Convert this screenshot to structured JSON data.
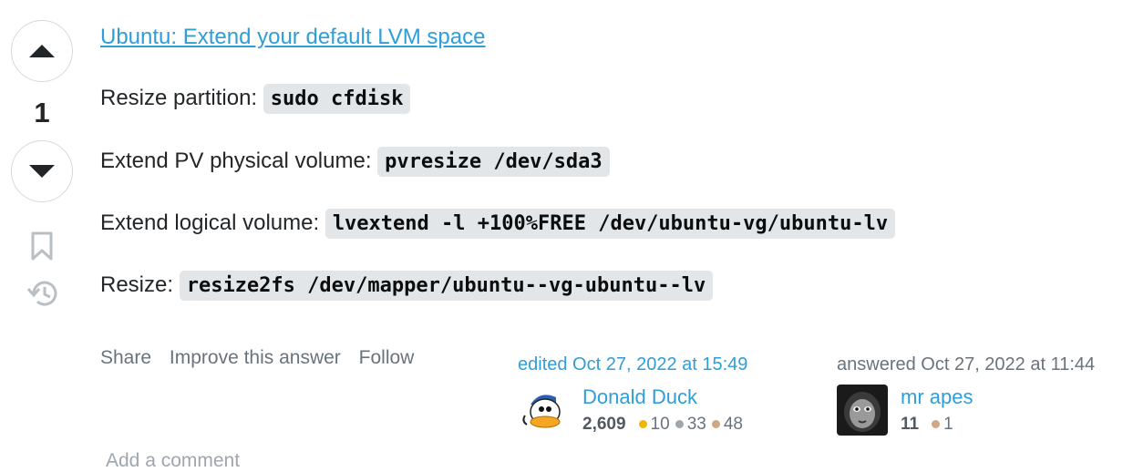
{
  "vote": {
    "count": "1"
  },
  "post": {
    "link_text": "Ubuntu: Extend your default LVM space",
    "steps": [
      {
        "label": "Resize partition:",
        "code": "sudo cfdisk"
      },
      {
        "label": "Extend PV physical volume:",
        "code": "pvresize /dev/sda3"
      },
      {
        "label": "Extend logical volume:",
        "code": "lvextend -l +100%FREE /dev/ubuntu-vg/ubuntu-lv"
      },
      {
        "label": "Resize:",
        "code": "resize2fs /dev/mapper/ubuntu--vg-ubuntu--lv"
      }
    ]
  },
  "menu": {
    "share": "Share",
    "improve": "Improve this answer",
    "follow": "Follow"
  },
  "editor": {
    "action": "edited Oct 27, 2022 at 15:49",
    "name": "Donald Duck",
    "reputation": "2,609",
    "gold": "10",
    "silver": "33",
    "bronze": "48"
  },
  "author": {
    "action": "answered Oct 27, 2022 at 11:44",
    "name": "mr apes",
    "reputation": "11",
    "bronze": "1"
  },
  "comments": {
    "add_label": "Add a comment"
  },
  "colors": {
    "link": "#2f9ed8",
    "gold": "#f1b600",
    "silver": "#9fa6ad",
    "bronze": "#d1a684"
  }
}
